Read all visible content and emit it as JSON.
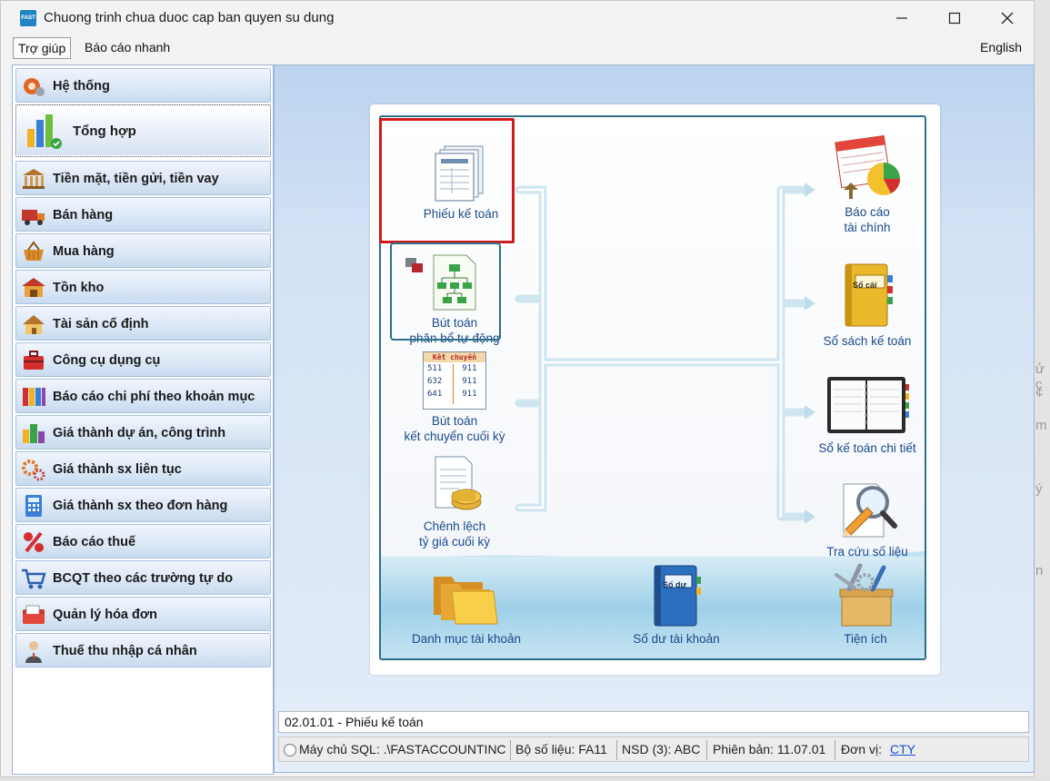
{
  "window": {
    "title": "Chuong trinh chua duoc cap ban quyen su dung",
    "app_icon_text": "FAST"
  },
  "menu": {
    "help": "Trợ giúp",
    "quick_report": "Báo cáo nhanh",
    "language": "English"
  },
  "sidebar": {
    "items": [
      {
        "label": "Hệ thống",
        "icon": "gear-icon"
      },
      {
        "label": "Tổng hợp",
        "icon": "chart-bars-icon"
      },
      {
        "label": "Tiền mặt, tiền gửi, tiền vay",
        "icon": "bank-icon"
      },
      {
        "label": "Bán hàng",
        "icon": "truck-icon"
      },
      {
        "label": "Mua hàng",
        "icon": "basket-icon"
      },
      {
        "label": "Tồn kho",
        "icon": "warehouse-icon"
      },
      {
        "label": "Tài sản cố định",
        "icon": "house-icon"
      },
      {
        "label": "Công cụ dụng cụ",
        "icon": "toolbox-icon"
      },
      {
        "label": "Báo cáo chi phí theo khoản mục",
        "icon": "binders-icon"
      },
      {
        "label": "Giá thành dự án, công trình",
        "icon": "buildings-icon"
      },
      {
        "label": "Giá thành sx liên tục",
        "icon": "gears-icon"
      },
      {
        "label": "Giá thành sx theo đơn hàng",
        "icon": "calculator-icon"
      },
      {
        "label": "Báo cáo thuế",
        "icon": "percent-icon"
      },
      {
        "label": "BCQT theo các trường tự do",
        "icon": "cart-icon"
      },
      {
        "label": "Quản lý hóa đơn",
        "icon": "invoice-folder-icon"
      },
      {
        "label": "Thuế thu nhập cá nhân",
        "icon": "person-icon"
      }
    ]
  },
  "diagram": {
    "phieu_ke_toan": "Phiếu kế toán",
    "but_toan_pb_1": "Bút toán",
    "but_toan_pb_2": "phân bổ tự động",
    "but_toan_kc_1": "Bút toán",
    "but_toan_kc_2": "kết chuyển cuối kỳ",
    "chenh_lech_1": "Chênh lệch",
    "chenh_lech_2": "tỷ giá cuối kỳ",
    "bao_cao_tc_1": "Báo cáo",
    "bao_cao_tc_2": "tài chính",
    "so_sach": "Sổ sách kế toán",
    "so_chi_tiet": "Sổ kế toán chi tiết",
    "tra_cuu": "Tra cứu số liệu",
    "danh_muc": "Danh mục tài khoản",
    "so_du": "Số dư tài khoản",
    "tien_ich": "Tiện ích",
    "ket_chuyen_card_title": "Kết chuyển",
    "ket_chuyen_rows": [
      "511",
      "911",
      "632",
      "911",
      "641",
      "911"
    ],
    "so_cai_label": "Sổ cái",
    "so_du_label": "Số dư"
  },
  "status": {
    "path": "02.01.01 - Phiếu kế toán",
    "server": "Máy chủ SQL: .\\FASTACCOUNTINC",
    "dataset": "Bộ số liệu: FA11",
    "user": "NSD (3): ABC",
    "version": "Phiên bản: 11.07.01",
    "unit_label": "Đơn vị:",
    "unit_value": "CTY"
  },
  "colors": {
    "highlight": "#d11b1b",
    "nav_gradient_top": "#f1f6fc",
    "nav_gradient_bottom": "#c9dbf0",
    "diagram_text": "#1a4a8a",
    "link": "#1b4fd1"
  }
}
